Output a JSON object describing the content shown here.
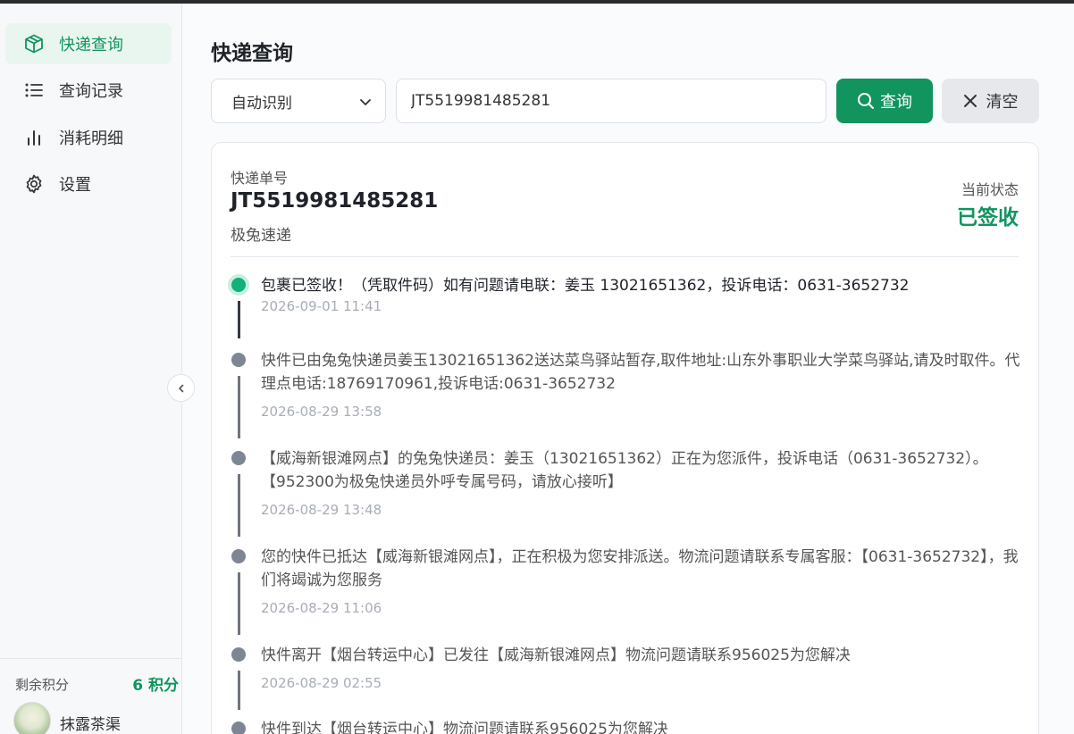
{
  "nav": {
    "items": [
      {
        "label": "快递查询",
        "icon": "package-icon",
        "active": true
      },
      {
        "label": "查询记录",
        "icon": "list-icon",
        "active": false
      },
      {
        "label": "消耗明细",
        "icon": "bar-chart-icon",
        "active": false
      },
      {
        "label": "设置",
        "icon": "gear-icon",
        "active": false
      }
    ]
  },
  "account": {
    "points_label": "剩余积分",
    "points_value": "6 积分",
    "user_name": "抹露茶渠"
  },
  "page": {
    "title": "快递查询"
  },
  "search": {
    "carrier_select": "自动识别",
    "tracking_input": "JT5519981485281",
    "query_button": "查询",
    "clear_button": "清空"
  },
  "result": {
    "tracking_label": "快递单号",
    "tracking_number": "JT5519981485281",
    "carrier": "极兔速递",
    "status_label": "当前状态",
    "status_value": "已签收"
  },
  "events": [
    {
      "desc": "包裹已签收！（凭取件码）如有问题请电联：姜玉 13021651362，投诉电话：0631-3652732",
      "time": "2026-09-01 11:41"
    },
    {
      "desc": "快件已由兔兔快递员姜玉13021651362送达菜鸟驿站暂存,取件地址:山东外事职业大学菜鸟驿站,请及时取件。代理点电话:18769170961,投诉电话:0631-3652732",
      "time": "2026-08-29 13:58"
    },
    {
      "desc": "【威海新银滩网点】的兔兔快递员：姜玉（13021651362）正在为您派件，投诉电话（0631-3652732）。【952300为极兔快递员外呼专属号码，请放心接听】",
      "time": "2026-08-29 13:48"
    },
    {
      "desc": "您的快件已抵达【威海新银滩网点】，正在积极为您安排派送。物流问题请联系专属客服：【0631-3652732】，我们将竭诚为您服务",
      "time": "2026-08-29 11:06"
    },
    {
      "desc": "快件离开【烟台转运中心】已发往【威海新银滩网点】物流问题请联系956025为您解决",
      "time": "2026-08-29 02:55"
    },
    {
      "desc": "快件到达【烟台转运中心】物流问题请联系956025为您解决",
      "time": ""
    }
  ],
  "colors": {
    "accent": "#12945f",
    "active_nav_bg": "#e8f6ef",
    "first_dot": "#12b07a",
    "dot": "#7e8694"
  }
}
